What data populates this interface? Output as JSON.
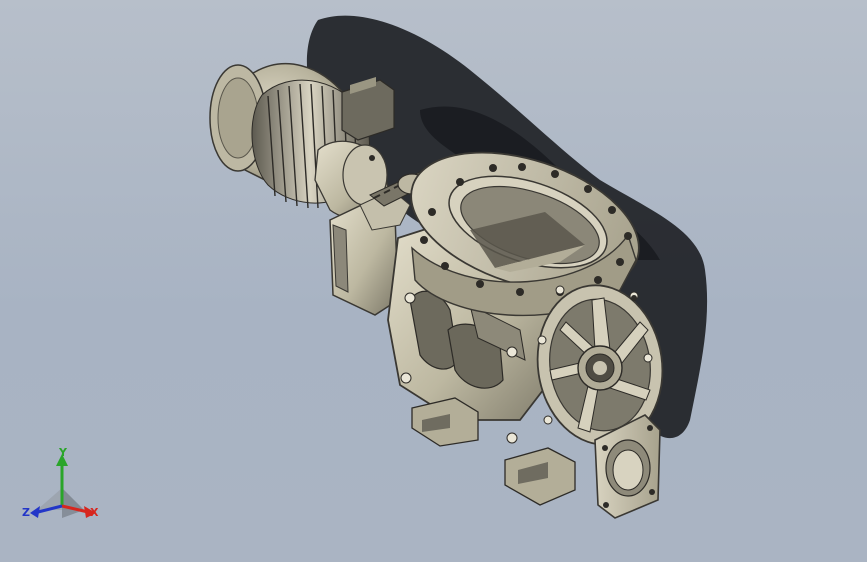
{
  "viewport": {
    "background_top": "#b7bfca",
    "background_bottom": "#aab4c3",
    "model_color": "#b9b59e",
    "shadow_color": "#1f2226"
  },
  "triad": {
    "x_label": "X",
    "y_label": "Y",
    "z_label": "Z",
    "x_color": "#d7261e",
    "y_color": "#2aa52a",
    "z_color": "#2336c8"
  }
}
